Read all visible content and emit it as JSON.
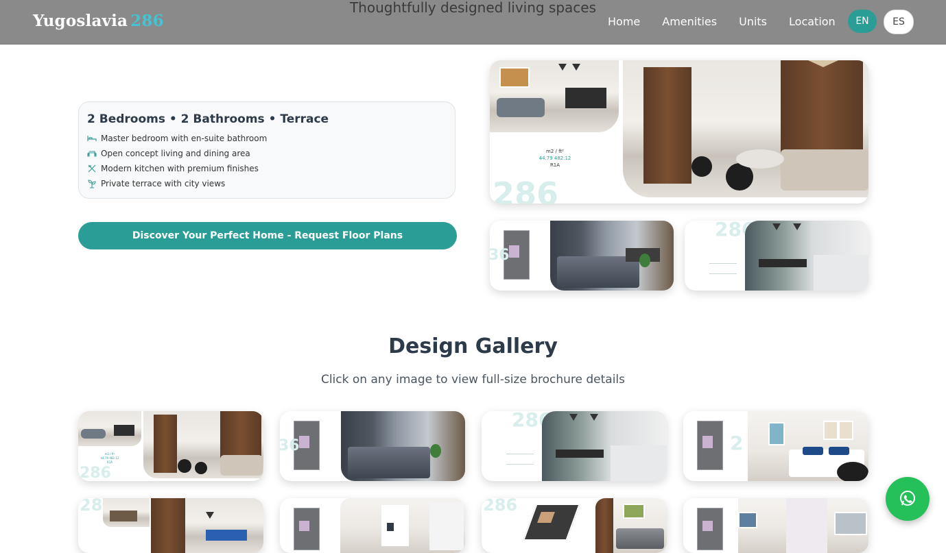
{
  "header": {
    "tagline": "Thoughtfully designed living spaces",
    "logo_name": "Yugoslavia",
    "logo_number": "286",
    "nav": [
      "Home",
      "Amenities",
      "Units",
      "Location"
    ],
    "lang_en": "EN",
    "lang_es": "ES"
  },
  "features": {
    "title": "2 Bedrooms • 2 Bathrooms • Terrace",
    "items": [
      {
        "icon": "bed-icon",
        "label": "Master bedroom with en-suite bathroom"
      },
      {
        "icon": "sofa-icon",
        "label": "Open concept living and dining area"
      },
      {
        "icon": "utensils-icon",
        "label": "Modern kitchen with premium finishes"
      },
      {
        "icon": "plant-icon",
        "label": "Private terrace with city views"
      }
    ],
    "cta": "Discover Your Perfect Home - Request Floor Plans"
  },
  "showcase": {
    "main_meta": {
      "units": "m2  /  ft²",
      "values": "44.79 482.12",
      "code": "R1A"
    },
    "watermark": "286"
  },
  "gallery": {
    "title": "Design Gallery",
    "subtitle": "Click on any image to view full-size brochure details"
  },
  "colors": {
    "accent": "#2a9d96",
    "logo_number": "#43c3d3",
    "whatsapp": "#25c05a",
    "heading": "#2d3a4a"
  },
  "whatsapp": {
    "icon": "whatsapp-icon"
  }
}
